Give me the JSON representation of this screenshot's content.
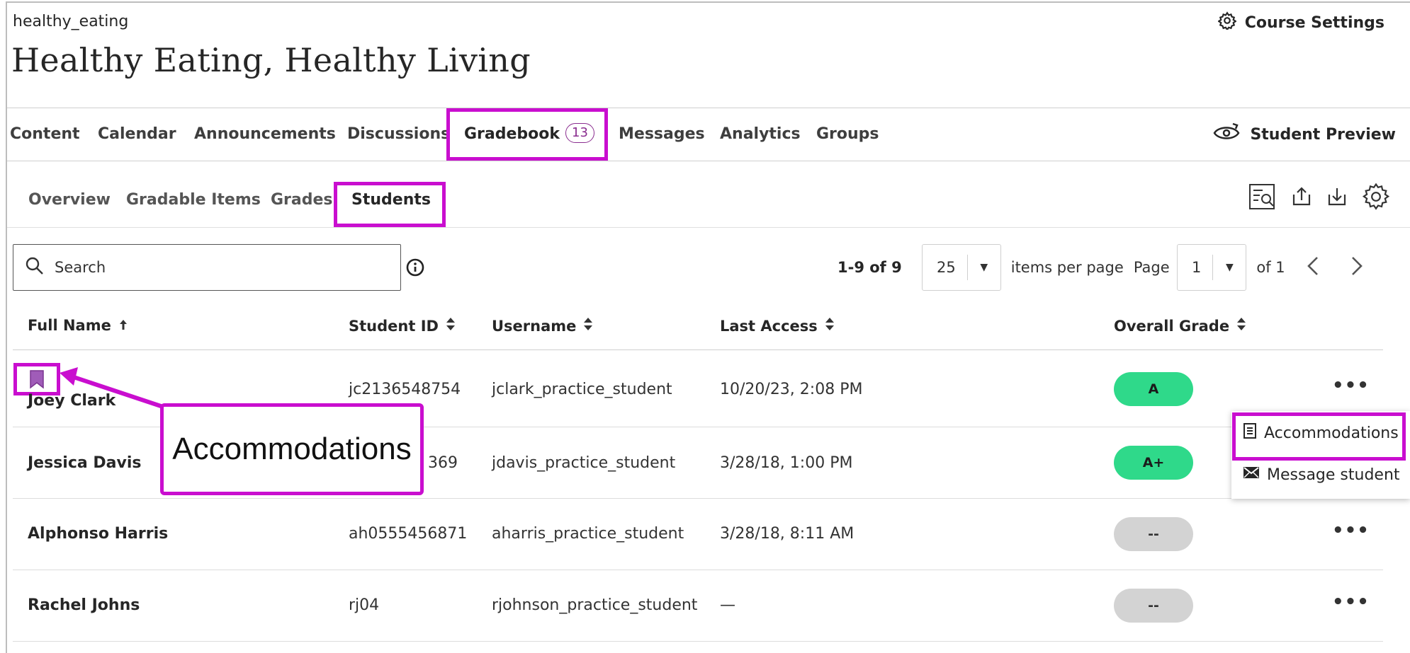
{
  "course": {
    "id": "healthy_eating",
    "title": "Healthy Eating, Healthy Living",
    "settings_label": "Course Settings"
  },
  "nav": {
    "items": [
      "Content",
      "Calendar",
      "Announcements",
      "Discussions",
      "Gradebook",
      "Messages",
      "Analytics",
      "Groups"
    ],
    "gradebook_badge": "13",
    "student_preview": "Student Preview"
  },
  "subnav": {
    "items": [
      "Overview",
      "Gradable Items",
      "Grades",
      "Students"
    ]
  },
  "search": {
    "placeholder": "Search"
  },
  "pager": {
    "range": "1-9 of 9",
    "per_page": "25",
    "per_page_label": "items per page",
    "page_label": "Page",
    "page": "1",
    "of_label": "of 1"
  },
  "table": {
    "headers": [
      "Full Name",
      "Student ID",
      "Username",
      "Last Access",
      "Overall Grade"
    ],
    "rows": [
      {
        "name": "Joey Clark",
        "id": "jc2136548754",
        "username": "jclark_practice_student",
        "last_access": "10/20/23, 2:08 PM",
        "grade": "A"
      },
      {
        "name": "Jessica Davis",
        "id": "369",
        "username": "jdavis_practice_student",
        "last_access": "3/28/18, 1:00 PM",
        "grade": "A+"
      },
      {
        "name": "Alphonso Harris",
        "id": "ah0555456871",
        "username": "aharris_practice_student",
        "last_access": "3/28/18, 8:11 AM",
        "grade": "--"
      },
      {
        "name": "Rachel Johns",
        "id": "rj04",
        "username": "rjohnson_practice_student",
        "last_access": "—",
        "grade": "--"
      }
    ]
  },
  "row_menu": {
    "accommodations": "Accommodations",
    "message": "Message student"
  },
  "callout": {
    "label": "Accommodations"
  },
  "colors": {
    "highlight": "#c90ecf",
    "grade_green": "#2fd98a",
    "grade_grey": "#d3d3d3",
    "badge": "#8a2d8f"
  }
}
